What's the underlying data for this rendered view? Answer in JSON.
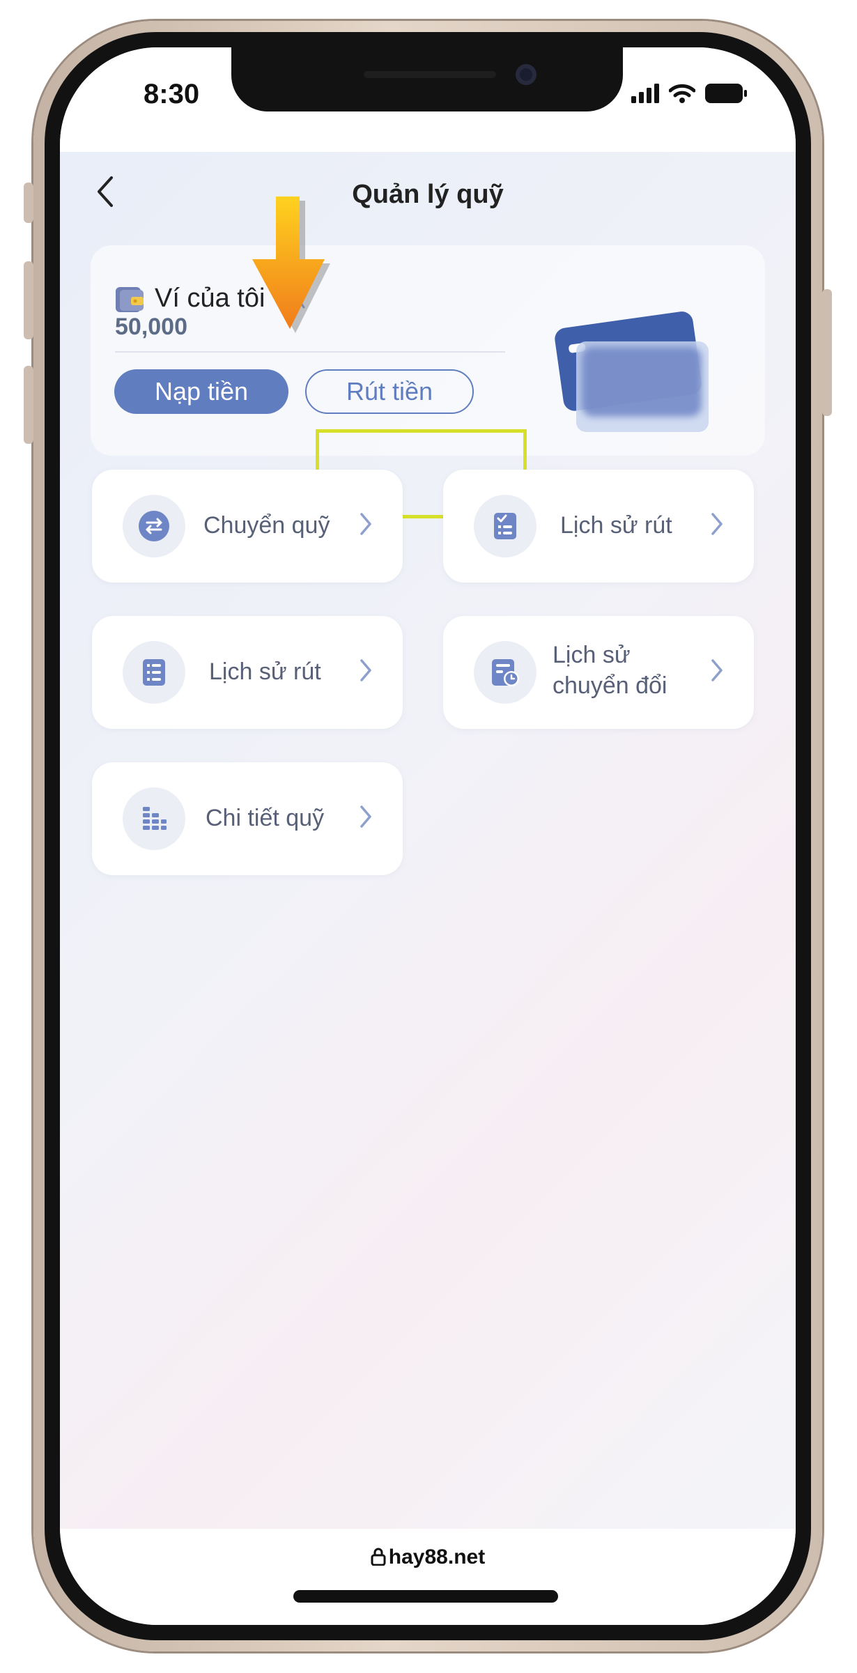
{
  "status_bar": {
    "time": "8:30"
  },
  "header": {
    "title": "Quản lý quỹ"
  },
  "wallet": {
    "label": "Ví của tôi",
    "balance": "50,000",
    "deposit_label": "Nạp tiền",
    "withdraw_label": "Rút tiền"
  },
  "menu": [
    {
      "label": "Chuyển quỹ",
      "icon": "transfer-icon"
    },
    {
      "label": "Lịch sử rút",
      "icon": "checklist-icon"
    },
    {
      "label": "Lịch sử rút",
      "icon": "list-icon"
    },
    {
      "label_line1": "Lịch sử",
      "label_line2": "chuyển đổi",
      "icon": "clock-doc-icon"
    },
    {
      "label": "Chi tiết quỹ",
      "icon": "bars-icon"
    }
  ],
  "footer": {
    "url": "hay88.net"
  },
  "colors": {
    "accent": "#5f7dbf",
    "highlight": "#d6e02a",
    "arrow": "#f39c1e"
  }
}
